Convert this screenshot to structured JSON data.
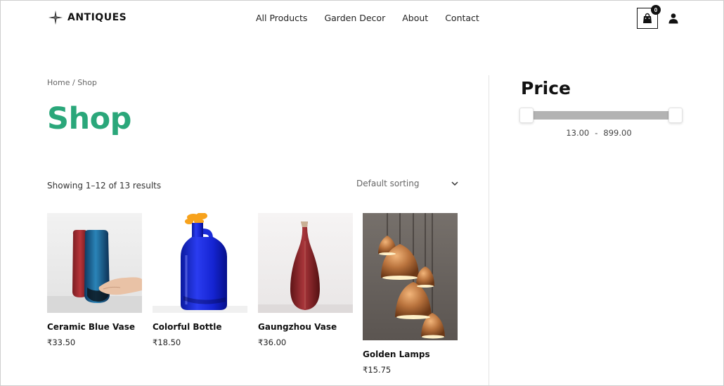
{
  "header": {
    "logo_text": "ANTIQUES",
    "nav": [
      "All Products",
      "Garden Decor",
      "About",
      "Contact"
    ],
    "cart_count": "0"
  },
  "breadcrumb": {
    "home": "Home",
    "separator": " / ",
    "current": "Shop"
  },
  "page": {
    "title": "Shop",
    "result_count": "Showing 1–12 of 13 results",
    "sorting": "Default sorting"
  },
  "products": [
    {
      "name": "Ceramic Blue Vase",
      "price": "₹33.50"
    },
    {
      "name": "Colorful Bottle",
      "price": "₹18.50"
    },
    {
      "name": "Gaungzhou Vase",
      "price": "₹36.00"
    },
    {
      "name": "Golden Lamps",
      "price": "₹15.75"
    }
  ],
  "sidebar": {
    "price_title": "Price",
    "min_price": "13.00",
    "range_separator": "-",
    "max_price": "899.00"
  },
  "colors": {
    "accent": "#2aa77a",
    "slider_track": "#b3b3b3"
  }
}
